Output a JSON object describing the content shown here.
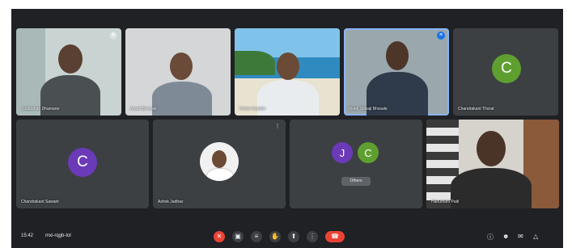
{
  "meeting": {
    "time": "15:42",
    "meeting_code": "mxi-rqgb-tol"
  },
  "participants": [
    {
      "name": "Sudarshan Dhamane"
    },
    {
      "name": "Anant Bhosale"
    },
    {
      "name": "Kishor Kamble"
    },
    {
      "name": "Vivek Shivaji Bhosale"
    },
    {
      "name": "Chandrakant Thorat",
      "initial": "C",
      "color": "#5f9f2f"
    },
    {
      "name": "Chandrakant Sawant",
      "initial": "C",
      "color": "#6a3ab8"
    },
    {
      "name": "Ashok Jadhav"
    },
    {
      "name": "",
      "chip": "Others"
    },
    {
      "name": "Hanumant Patil"
    }
  ],
  "group_tile": {
    "initial_a": "J",
    "initial_b": "C",
    "color_a": "#6a3ab8",
    "color_b": "#5f9f2f"
  },
  "toolbar": {
    "icons": [
      "mic-off",
      "camera",
      "captions",
      "raise-hand",
      "present",
      "more",
      "end-call"
    ],
    "right_icons": [
      "info",
      "people",
      "chat",
      "activities"
    ]
  },
  "colors": {
    "background": "#202124",
    "tile": "#3c4043",
    "end_call": "#ea4335"
  }
}
